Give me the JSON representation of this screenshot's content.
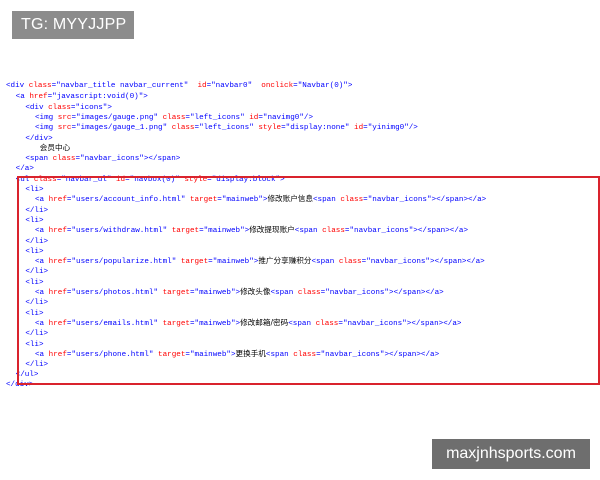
{
  "badge": {
    "text": "TG: MYYJJPP"
  },
  "watermark": {
    "text": "maxjnhsports.com"
  },
  "code": {
    "lines": [
      "<div class=\"navbar_title navbar_current\"  id=\"navbar0\"  onclick=\"Navbar(0)\">",
      "    <a href=\"javascript:void(0)\">",
      "        <div class=\"icons\">",
      "            <img src=\"images/gauge.png\" class=\"left_icons\" id=\"navimg0\"/>",
      "            <img src=\"images/gauge_1.png\" class=\"left_icons\" style=\"display:none\" id=\"yinimg0\"/>",
      "        </div>",
      "              会员中心",
      "        <span class=\"navbar_icons\"></span>",
      "    </a>",
      "    <ul class=\"navbar_ul\" id=\"navbox(0)\" style=\"display:block\">",
      "        <li>",
      "            <a href=\"users/account_info.html\" target=\"mainweb\">修改账户信息<span class=\"navbar_icons\"></span></a>",
      "        </li>",
      "        <li>",
      "            <a href=\"users/withdraw.html\" target=\"mainweb\">修改提现账户<span class=\"navbar_icons\"></span></a>",
      "        </li>",
      "        <li>",
      "            <a href=\"users/popularize.html\" target=\"mainweb\">推广分享赚积分<span class=\"navbar_icons\"></span></a>",
      "        </li>",
      "        <li>",
      "            <a href=\"users/photos.html\" target=\"mainweb\">修改头像<span class=\"navbar_icons\"></span></a>",
      "        </li>",
      "        <li>",
      "            <a href=\"users/emails.html\" target=\"mainweb\">修改邮箱/密码<span class=\"navbar_icons\"></span></a>",
      "        </li>",
      "        <li>",
      "            <a href=\"users/phone.html\" target=\"mainweb\">更换手机<span class=\"navbar_icons\"></span></a>",
      "        </li>",
      "    </ul>",
      "</div>"
    ]
  },
  "highlight": {
    "color": "#d9232d"
  }
}
